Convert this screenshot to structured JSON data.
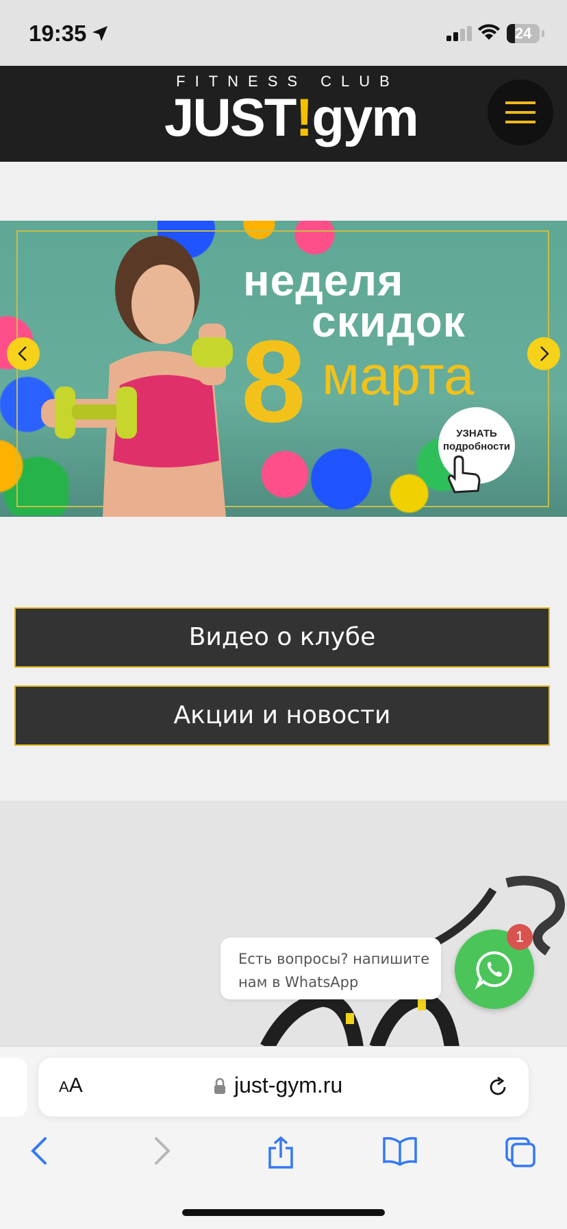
{
  "status_bar": {
    "time": "19:35",
    "battery": "24",
    "battery_level": 0.24
  },
  "header": {
    "logo_subtitle": "FITNESS CLUB",
    "logo_main_before": "JUST",
    "logo_main_accent": "!",
    "logo_main_after": "gym",
    "menu_icon": "hamburger-icon"
  },
  "banner": {
    "line1": "неделя",
    "line2": "скидок",
    "number": "8",
    "line3": "марта",
    "details_button": "УЗНАТЬ подробности",
    "prev_icon": "chevron-left-icon",
    "next_icon": "chevron-right-icon"
  },
  "buttons": {
    "video": "Видео о клубе",
    "news": "Акции и новости"
  },
  "chat_widget": {
    "message": "Есть вопросы? напишите нам в WhatsApp",
    "badge": "1",
    "icon": "whatsapp-icon"
  },
  "safari": {
    "text_size_label_small": "A",
    "text_size_label_large": "A",
    "url": "just-gym.ru"
  },
  "colors": {
    "accent": "#f2c21b",
    "header_bg": "#1f1f1f",
    "button_bg": "#333333",
    "whatsapp": "#4bc55a",
    "ios_blue": "#3478f6"
  }
}
